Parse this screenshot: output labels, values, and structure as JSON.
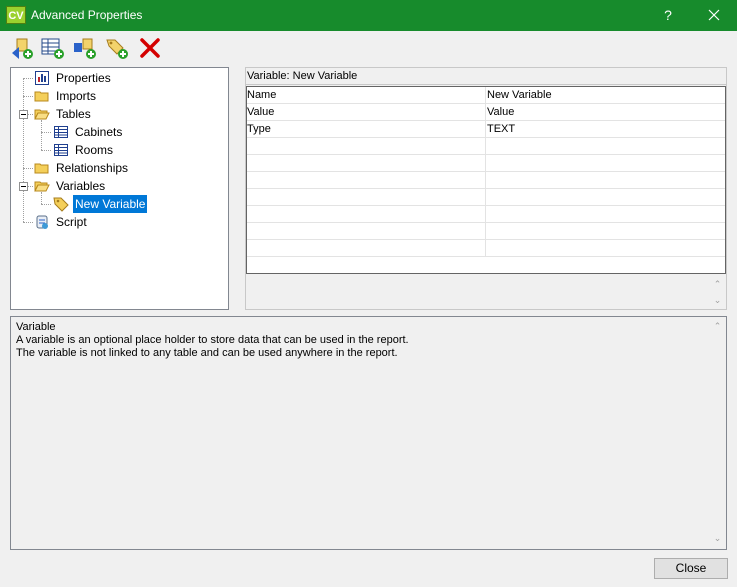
{
  "window": {
    "app_icon_text": "CV",
    "title": "Advanced Properties",
    "help_label": "?",
    "titlebar_color": "#178b2c"
  },
  "toolbar": {
    "buttons": [
      {
        "name": "add-properties-icon"
      },
      {
        "name": "add-table-icon"
      },
      {
        "name": "add-relationship-icon"
      },
      {
        "name": "add-variable-icon"
      },
      {
        "name": "delete-icon"
      }
    ]
  },
  "tree": {
    "items": [
      {
        "label": "Properties",
        "icon": "properties-icon"
      },
      {
        "label": "Imports",
        "icon": "folder-icon"
      },
      {
        "label": "Tables",
        "icon": "folder-icon"
      },
      {
        "label": "Cabinets",
        "icon": "table-icon"
      },
      {
        "label": "Rooms",
        "icon": "table-icon"
      },
      {
        "label": "Relationships",
        "icon": "folder-icon"
      },
      {
        "label": "Variables",
        "icon": "folder-icon"
      },
      {
        "label": "New Variable",
        "icon": "variable-tag-icon",
        "selected": true
      },
      {
        "label": "Script",
        "icon": "script-icon"
      }
    ]
  },
  "grid": {
    "header": "Variable: New Variable",
    "rows": [
      [
        "Name",
        "New Variable"
      ],
      [
        "Value",
        "Value"
      ],
      [
        "Type",
        "TEXT"
      ],
      [
        "",
        ""
      ],
      [
        "",
        ""
      ],
      [
        "",
        ""
      ],
      [
        "",
        ""
      ],
      [
        "",
        ""
      ],
      [
        "",
        ""
      ],
      [
        "",
        ""
      ]
    ]
  },
  "description": {
    "lines": [
      "Variable",
      "A variable is an optional place holder to store data that can be used in the report.",
      "The variable is not linked to any table and can be used anywhere in the report."
    ]
  },
  "footer": {
    "close_label": "Close"
  }
}
